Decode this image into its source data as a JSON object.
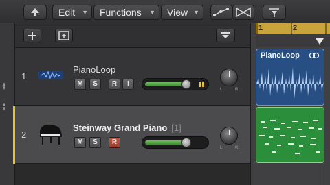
{
  "menubar": {
    "edit_label": "Edit",
    "functions_label": "Functions",
    "view_label": "View"
  },
  "icons": {
    "up": "up-arrow-icon",
    "add_track": "plus-icon",
    "global_tracks": "add-box-icon",
    "catch": "down-triangle-icon",
    "automation": "curve-icon",
    "flex": "flex-icon",
    "snap": "snap-icon"
  },
  "ruler": {
    "bar_1": "1",
    "bar_2": "2"
  },
  "tracks": [
    {
      "number": "1",
      "name": "PianoLoop",
      "buttons": [
        "M",
        "S",
        "R",
        "I"
      ],
      "volume_level": 0.68,
      "type": "audio"
    },
    {
      "number": "2",
      "name": "Steinway Grand Piano",
      "channel": "[1]",
      "buttons": [
        "M",
        "S",
        "R"
      ],
      "record_armed": true,
      "volume_level": 0.68,
      "type": "software-instrument"
    }
  ],
  "regions": {
    "audio_title": "PianoLoop"
  },
  "colors": {
    "audio_region": "#284f83",
    "midi_region": "#2b8e3a",
    "ruler": "#c9a33c",
    "selected_track": "#4b4b4d",
    "record": "#b5483a"
  }
}
